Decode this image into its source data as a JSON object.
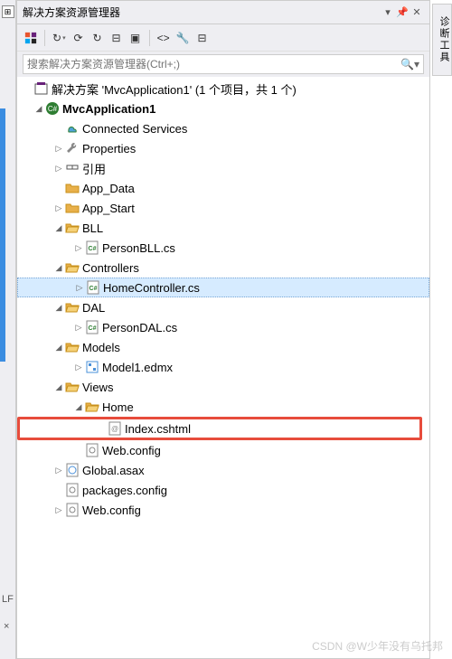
{
  "panel": {
    "title": "解决方案资源管理器"
  },
  "right_tab": "诊断工具",
  "left": {
    "lf": "LF",
    "close": "×"
  },
  "search": {
    "placeholder": "搜索解决方案资源管理器(Ctrl+;)"
  },
  "tree": {
    "solution": "解决方案 'MvcApplication1' (1 个项目，共 1 个)",
    "project": "MvcApplication1",
    "connected_services": "Connected Services",
    "properties": "Properties",
    "references": "引用",
    "app_data": "App_Data",
    "app_start": "App_Start",
    "bll": "BLL",
    "person_bll": "PersonBLL.cs",
    "controllers": "Controllers",
    "home_controller": "HomeController.cs",
    "dal": "DAL",
    "person_dal": "PersonDAL.cs",
    "models": "Models",
    "model1_edmx": "Model1.edmx",
    "views": "Views",
    "home": "Home",
    "index_cshtml": "Index.cshtml",
    "web_config_views": "Web.config",
    "global_asax": "Global.asax",
    "packages_config": "packages.config",
    "web_config": "Web.config"
  },
  "watermark": "CSDN @W少年没有乌托邦"
}
